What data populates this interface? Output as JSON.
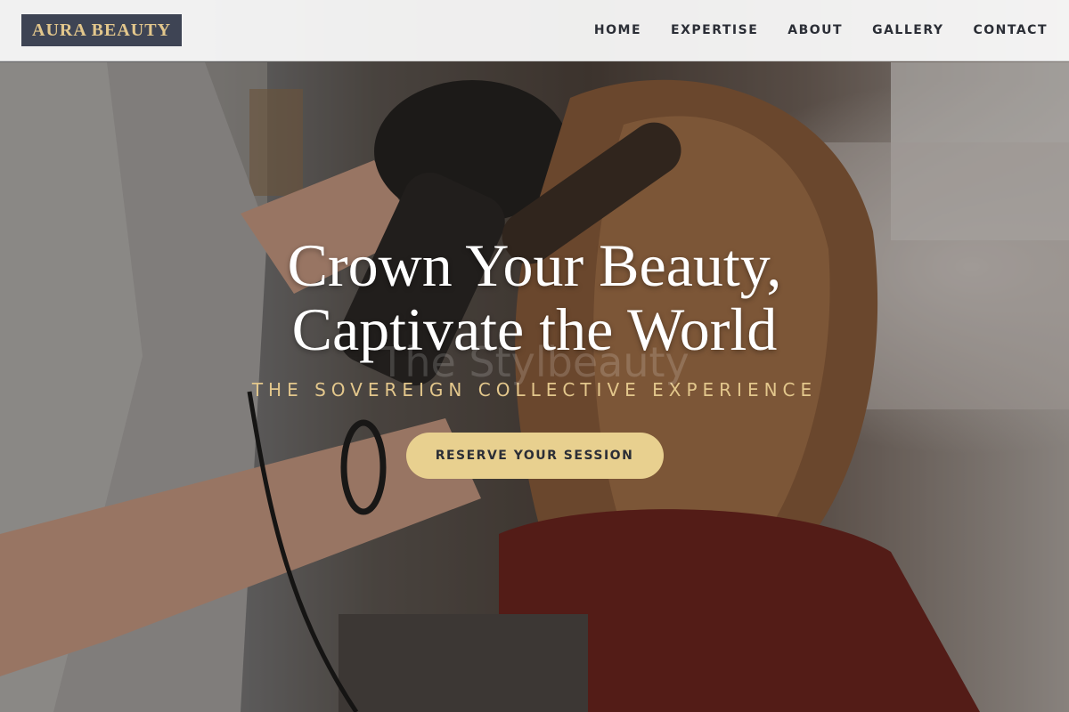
{
  "brand": {
    "name": "AURA BEAUTY"
  },
  "nav": {
    "items": [
      {
        "label": "HOME"
      },
      {
        "label": "EXPERTISE"
      },
      {
        "label": "ABOUT"
      },
      {
        "label": "GALLERY"
      },
      {
        "label": "CONTACT"
      }
    ]
  },
  "hero": {
    "title_line1": "Crown Your Beauty,",
    "title_line2": "Captivate the World",
    "ghost_text": "The Stylbeauty",
    "subtitle": "THE SOVEREIGN COLLECTIVE EXPERIENCE",
    "cta_label": "RESERVE YOUR SESSION"
  },
  "colors": {
    "logo_bg": "#3e4454",
    "accent_gold": "#e3c78c",
    "cta_bg": "#e8d08f",
    "nav_text": "#2b2e36"
  }
}
